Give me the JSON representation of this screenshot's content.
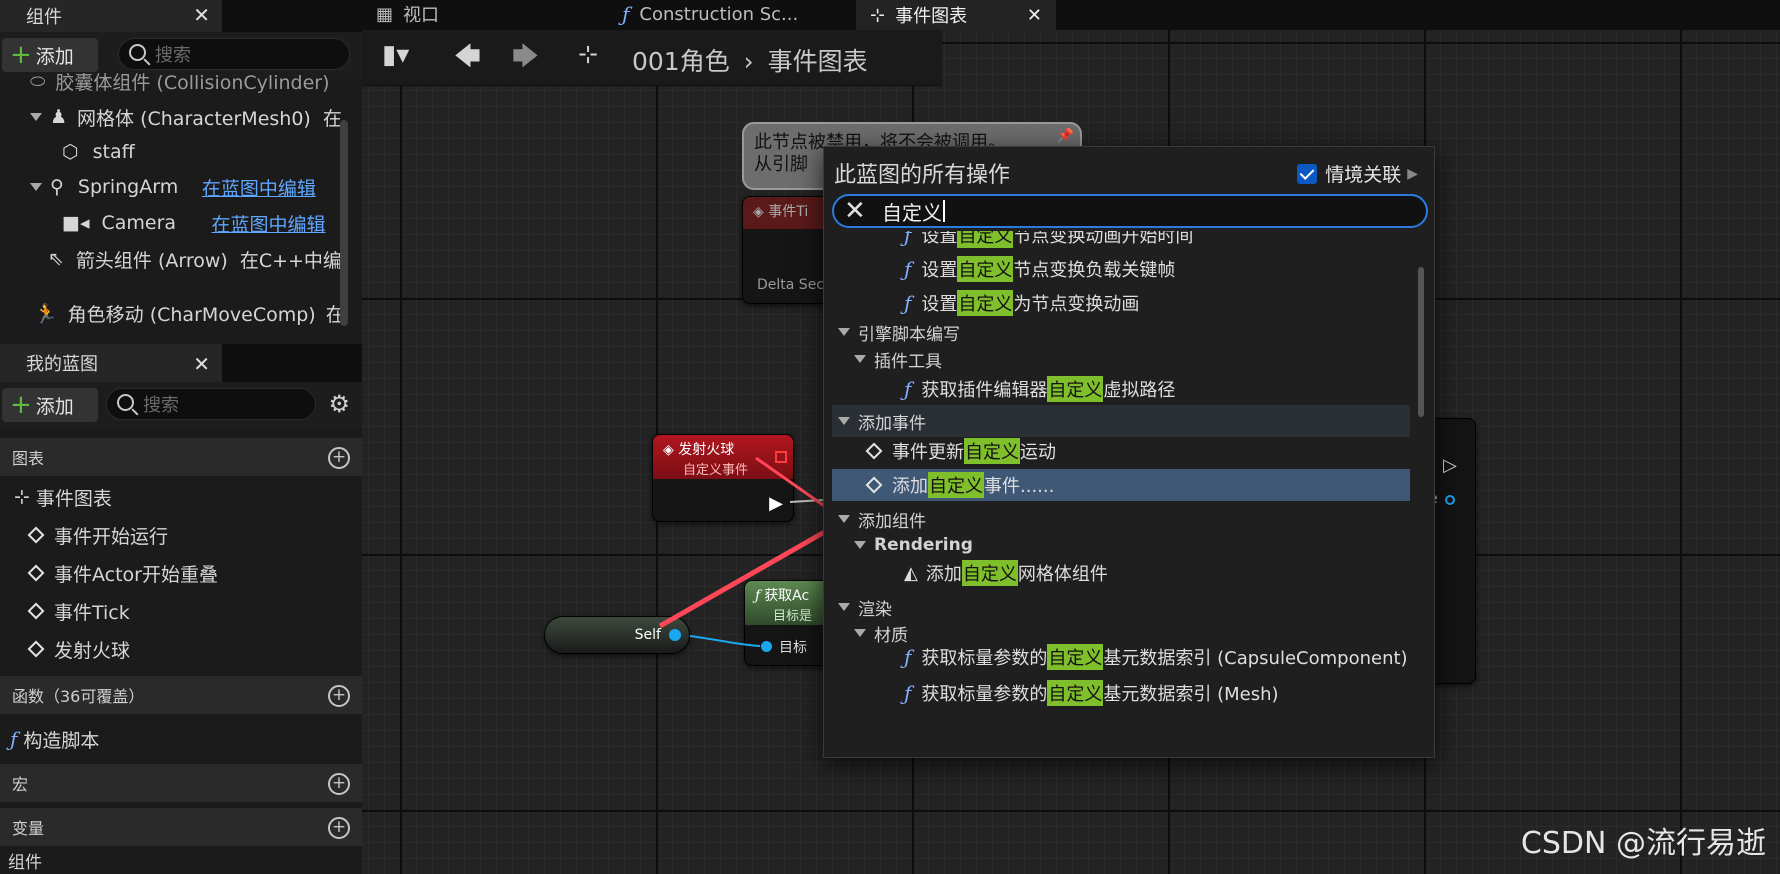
{
  "left_panel": {
    "components_tab": "组件",
    "add_label": "添加",
    "search_placeholder": "搜索",
    "tree": [
      {
        "name": "胶囊体组件 (CollisionCylinder)",
        "action": ""
      },
      {
        "name": "网格体 (CharacterMesh0)",
        "action": "在"
      },
      {
        "name": "staff",
        "action": ""
      },
      {
        "name": "SpringArm",
        "action": "在蓝图中编辑"
      },
      {
        "name": "Camera",
        "action": "在蓝图中编辑"
      },
      {
        "name": "箭头组件 (Arrow)",
        "action": "在C++中编"
      },
      {
        "name": "角色移动 (CharMoveComp)",
        "action": "在"
      }
    ],
    "myblueprint_tab": "我的蓝图",
    "sections": {
      "graphs": "图表",
      "functions": "函数（36可覆盖）",
      "macros": "宏",
      "variables": "变量",
      "components": "组件"
    },
    "graph_items": [
      "事件图表",
      "事件开始运行",
      "事件Actor开始重叠",
      "事件Tick",
      "发射火球"
    ],
    "function_items": [
      "构造脚本"
    ]
  },
  "top_tabs": [
    "视口",
    "Construction Sc...",
    "事件图表"
  ],
  "breadcrumb": {
    "root": "001角色",
    "current": "事件图表"
  },
  "nodes": {
    "comment_line1": "此节点被禁用，将不会被调用。",
    "comment_line2": "从引脚",
    "event_tick_label": "事件Ti",
    "delta_label": "Delta Seco",
    "fire_title": "发射火球",
    "fire_sub": "自定义事件",
    "self_label": "Self",
    "get_title": "获取Ac",
    "get_sub": "目标是",
    "target_label": "目标",
    "partial_e": "e"
  },
  "menu": {
    "title": "此蓝图的所有操作",
    "context_label": "情境关联",
    "context_checked": true,
    "search_value": "自定义",
    "rows": [
      {
        "type": "fn",
        "indent": 2,
        "pre": "设置",
        "hl": "自定义",
        "post": "节点变换动画开始时间"
      },
      {
        "type": "fn",
        "indent": 2,
        "pre": "设置",
        "hl": "自定义",
        "post": "节点变换负载关键帧"
      },
      {
        "type": "fn",
        "indent": 2,
        "pre": "设置",
        "hl": "自定义",
        "post": "为节点变换动画"
      },
      {
        "type": "cat",
        "indent": 0,
        "pre": "引擎脚本编写",
        "hl": "",
        "post": ""
      },
      {
        "type": "cat",
        "indent": 1,
        "pre": "插件工具",
        "hl": "",
        "post": ""
      },
      {
        "type": "fn",
        "indent": 2,
        "pre": "获取插件编辑器",
        "hl": "自定义",
        "post": "虚拟路径"
      },
      {
        "type": "cat",
        "indent": 0,
        "pre": "添加事件",
        "hl": "",
        "post": ""
      },
      {
        "type": "ev",
        "indent": 1,
        "pre": "事件更新",
        "hl": "自定义",
        "post": "运动"
      },
      {
        "type": "ev",
        "indent": 1,
        "pre": "添加",
        "hl": "自定义",
        "post": "事件......"
      },
      {
        "type": "cat",
        "indent": 0,
        "pre": "添加组件",
        "hl": "",
        "post": ""
      },
      {
        "type": "cat",
        "indent": 1,
        "pre": "Rendering",
        "hl": "",
        "post": ""
      },
      {
        "type": "mesh",
        "indent": 2,
        "pre": "添加",
        "hl": "自定义",
        "post": "网格体组件"
      },
      {
        "type": "cat",
        "indent": 0,
        "pre": "渲染",
        "hl": "",
        "post": ""
      },
      {
        "type": "cat",
        "indent": 1,
        "pre": "材质",
        "hl": "",
        "post": ""
      },
      {
        "type": "fn",
        "indent": 2,
        "pre": "获取标量参数的",
        "hl": "自定义",
        "post": "基元数据索引 (CapsuleComponent)"
      },
      {
        "type": "fn",
        "indent": 2,
        "pre": "获取标量参数的",
        "hl": "自定义",
        "post": "基元数据索引 (Mesh)"
      }
    ]
  },
  "watermark": "CSDN @流行易逝",
  "colors": {
    "highlight": "#7fbf2c",
    "selected_row": "#3f5876",
    "accent_blue": "#2c7be0",
    "event_red": "#a3121b",
    "arrow": "#ff4757"
  }
}
